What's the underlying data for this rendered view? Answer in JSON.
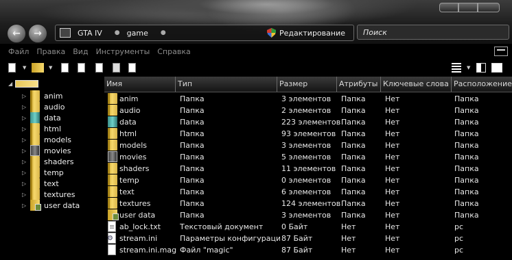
{
  "address": {
    "crumbs": [
      "GTA IV",
      "game"
    ],
    "edit_label": "Редактирование"
  },
  "search": {
    "placeholder": "Поиск"
  },
  "menu": [
    "Файл",
    "Правка",
    "Вид",
    "Инструменты",
    "Справка"
  ],
  "columns": [
    "Имя",
    "Тип",
    "Размер",
    "Атрибуты",
    "Ключевые слова",
    "Расположение"
  ],
  "tree": [
    {
      "label": "anim",
      "icon": "folder"
    },
    {
      "label": "audio",
      "icon": "folder"
    },
    {
      "label": "data",
      "icon": "data-folder"
    },
    {
      "label": "html",
      "icon": "folder"
    },
    {
      "label": "models",
      "icon": "folder"
    },
    {
      "label": "movies",
      "icon": "movies-folder"
    },
    {
      "label": "shaders",
      "icon": "folder"
    },
    {
      "label": "temp",
      "icon": "folder"
    },
    {
      "label": "text",
      "icon": "folder"
    },
    {
      "label": "textures",
      "icon": "folder"
    },
    {
      "label": "user data",
      "icon": "userdata-folder"
    }
  ],
  "files": [
    {
      "name": "anim",
      "type": "Папка",
      "size": "3 элементов",
      "attr": "Папка",
      "keywords": "Нет",
      "location": "Папка",
      "icon": "folder"
    },
    {
      "name": "audio",
      "type": "Папка",
      "size": "2 элементов",
      "attr": "Папка",
      "keywords": "Нет",
      "location": "Папка",
      "icon": "folder"
    },
    {
      "name": "data",
      "type": "Папка",
      "size": "223 элементов",
      "attr": "Папка",
      "keywords": "Нет",
      "location": "Папка",
      "icon": "data-folder"
    },
    {
      "name": "html",
      "type": "Папка",
      "size": "93 элементов",
      "attr": "Папка",
      "keywords": "Нет",
      "location": "Папка",
      "icon": "folder"
    },
    {
      "name": "models",
      "type": "Папка",
      "size": "3 элементов",
      "attr": "Папка",
      "keywords": "Нет",
      "location": "Папка",
      "icon": "folder"
    },
    {
      "name": "movies",
      "type": "Папка",
      "size": "5 элементов",
      "attr": "Папка",
      "keywords": "Нет",
      "location": "Папка",
      "icon": "movies-folder"
    },
    {
      "name": "shaders",
      "type": "Папка",
      "size": "11 элементов",
      "attr": "Папка",
      "keywords": "Нет",
      "location": "Папка",
      "icon": "folder"
    },
    {
      "name": "temp",
      "type": "Папка",
      "size": "0 элементов",
      "attr": "Папка",
      "keywords": "Нет",
      "location": "Папка",
      "icon": "folder"
    },
    {
      "name": "text",
      "type": "Папка",
      "size": "6 элементов",
      "attr": "Папка",
      "keywords": "Нет",
      "location": "Папка",
      "icon": "folder"
    },
    {
      "name": "textures",
      "type": "Папка",
      "size": "124 элементов",
      "attr": "Папка",
      "keywords": "Нет",
      "location": "Папка",
      "icon": "folder"
    },
    {
      "name": "user data",
      "type": "Папка",
      "size": "3 элементов",
      "attr": "Папка",
      "keywords": "Нет",
      "location": "Папка",
      "icon": "userdata-folder"
    },
    {
      "name": "ab_lock.txt",
      "type": "Текстовый документ",
      "size": "0 Байт",
      "attr": "Нет",
      "keywords": "Нет",
      "location": "pc",
      "icon": "doc"
    },
    {
      "name": "stream.ini",
      "type": "Параметры конфигурации",
      "size": "87 Байт",
      "attr": "Нет",
      "keywords": "Нет",
      "location": "pc",
      "icon": "ini"
    },
    {
      "name": "stream.ini.magic",
      "type": "Файл \"magic\"",
      "size": "87 Байт",
      "attr": "Нет",
      "keywords": "Нет",
      "location": "pc",
      "icon": "blank"
    }
  ]
}
